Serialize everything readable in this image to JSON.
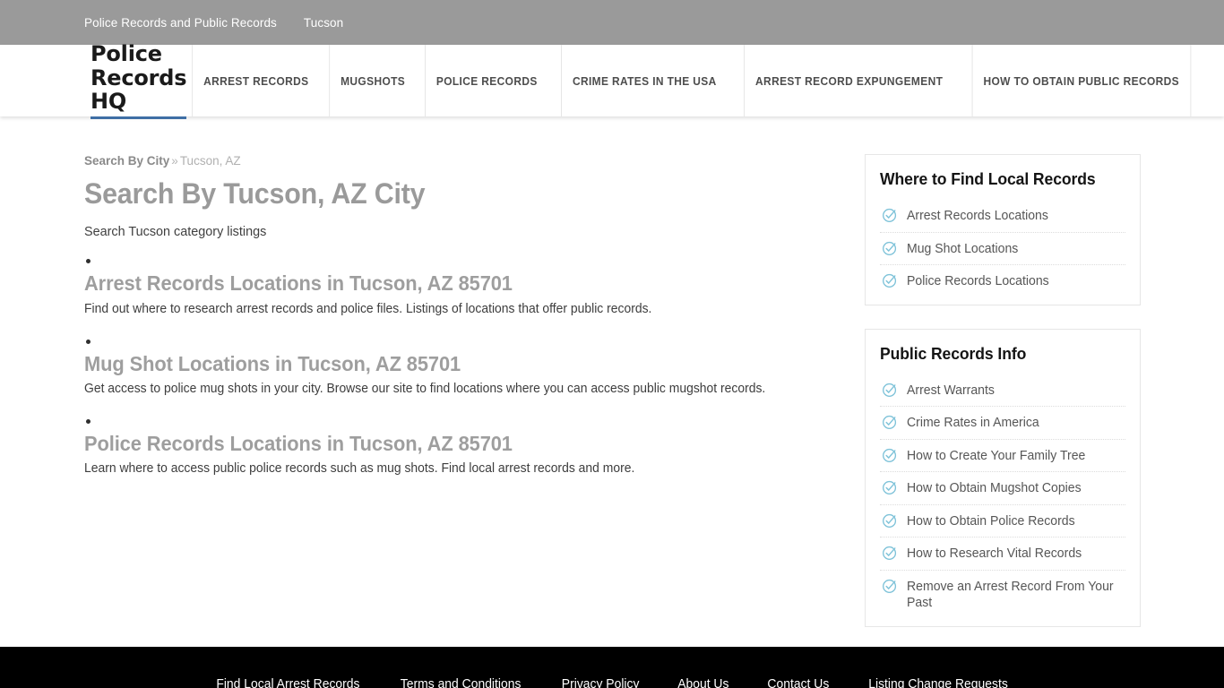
{
  "topbar": {
    "links": [
      {
        "label": "Police Records and Public Records"
      },
      {
        "label": "Tucson"
      }
    ]
  },
  "header": {
    "logo": "Police Records HQ",
    "logo_underline_color": "#3f6fa5",
    "nav": [
      {
        "label": "ARREST RECORDS"
      },
      {
        "label": "MUGSHOTS"
      },
      {
        "label": "POLICE RECORDS"
      },
      {
        "label": "CRIME RATES IN THE USA"
      },
      {
        "label": "ARREST RECORD EXPUNGEMENT"
      },
      {
        "label": "HOW TO OBTAIN PUBLIC RECORDS"
      }
    ]
  },
  "breadcrumb": {
    "root": "Search By City",
    "separator": "»",
    "current": "Tucson, AZ"
  },
  "main": {
    "title": "Search By Tucson, AZ City",
    "intro": "Search Tucson category listings",
    "listings": [
      {
        "title": "Arrest Records Locations in Tucson, AZ 85701",
        "description": "Find out where to research arrest records and police files. Listings of locations that offer public records."
      },
      {
        "title": "Mug Shot Locations in Tucson, AZ 85701",
        "description": "Get access to police mug shots in your city. Browse our site to find locations where you can access public mugshot records."
      },
      {
        "title": "Police Records Locations in Tucson, AZ 85701",
        "description": "Learn where to access public police records such as mug shots. Find local arrest records and more."
      }
    ]
  },
  "sidebar": {
    "accent_color": "#7fc3d9",
    "widgets": [
      {
        "title": "Where to Find Local Records",
        "items": [
          {
            "label": "Arrest Records Locations",
            "icon": "check-circle-icon"
          },
          {
            "label": "Mug Shot Locations",
            "icon": "check-circle-icon"
          },
          {
            "label": "Police Records Locations",
            "icon": "check-circle-icon"
          }
        ]
      },
      {
        "title": "Public Records Info",
        "items": [
          {
            "label": "Arrest Warrants",
            "icon": "check-circle-icon"
          },
          {
            "label": "Crime Rates in America",
            "icon": "check-circle-icon"
          },
          {
            "label": "How to Create Your Family Tree",
            "icon": "check-circle-icon"
          },
          {
            "label": "How to Obtain Mugshot Copies",
            "icon": "check-circle-icon"
          },
          {
            "label": "How to Obtain Police Records",
            "icon": "check-circle-icon"
          },
          {
            "label": "How to Research Vital Records",
            "icon": "check-circle-icon"
          },
          {
            "label": "Remove an Arrest Record From Your Past",
            "icon": "check-circle-icon"
          }
        ]
      }
    ]
  },
  "footer": {
    "background": "#000000",
    "links": [
      {
        "label": "Find Local Arrest Records"
      },
      {
        "label": "Terms and Conditions"
      },
      {
        "label": "Privacy Policy"
      },
      {
        "label": "About Us"
      },
      {
        "label": "Contact Us"
      },
      {
        "label": "Listing Change Requests"
      }
    ]
  }
}
